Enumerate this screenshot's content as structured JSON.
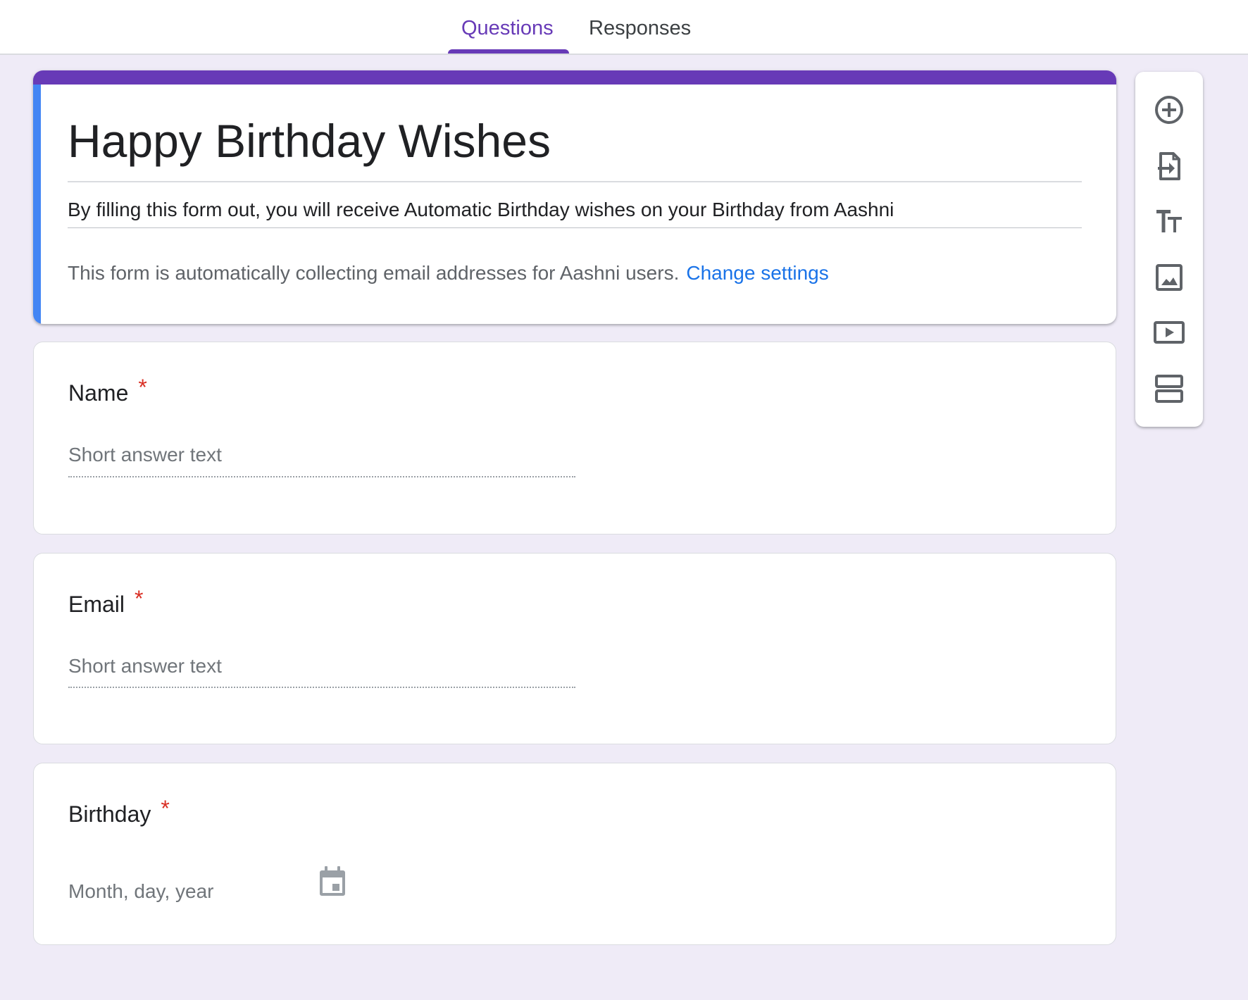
{
  "tabs": [
    {
      "label": "Questions",
      "active": true
    },
    {
      "label": "Responses",
      "active": false
    }
  ],
  "form": {
    "title": "Happy Birthday Wishes",
    "description": "By filling this form out, you will receive Automatic Birthday wishes on your Birthday from Aashni",
    "email_note": "This form is automatically collecting email addresses for Aashni users.",
    "change_settings_label": "Change settings"
  },
  "questions": [
    {
      "title": "Name",
      "required_mark": "*",
      "placeholder": "Short answer text",
      "type": "short-answer"
    },
    {
      "title": "Email",
      "required_mark": "*",
      "placeholder": "Short answer text",
      "type": "short-answer"
    },
    {
      "title": "Birthday",
      "required_mark": "*",
      "placeholder": "Month, day, year",
      "type": "date"
    }
  ],
  "toolbar": {
    "tools": [
      "add-question-icon",
      "import-questions-icon",
      "add-title-icon",
      "add-image-icon",
      "add-video-icon",
      "add-section-icon"
    ]
  },
  "colors": {
    "accent": "#673ab7",
    "header_stripe": "#4285f4",
    "link": "#1a73e8",
    "required": "#d93025",
    "background": "#efebf7"
  }
}
